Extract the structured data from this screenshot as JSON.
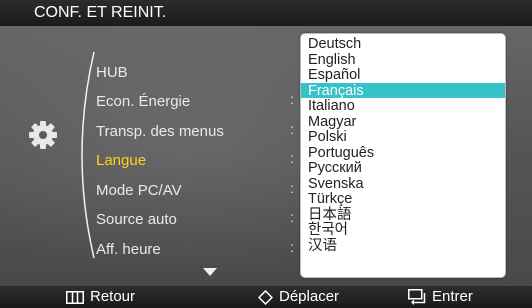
{
  "header": {
    "title": "CONF. ET REINIT."
  },
  "menu": {
    "items": [
      {
        "label": "HUB",
        "selected": false
      },
      {
        "label": "Econ. Énergie",
        "selected": false
      },
      {
        "label": "Transp. des menus",
        "selected": false
      },
      {
        "label": "Langue",
        "selected": true
      },
      {
        "label": "Mode PC/AV",
        "selected": false
      },
      {
        "label": "Source auto",
        "selected": false
      },
      {
        "label": "Aff. heure",
        "selected": false
      }
    ],
    "separator": ":"
  },
  "languages": {
    "options": [
      "Deutsch",
      "English",
      "Español",
      "Français",
      "Italiano",
      "Magyar",
      "Polski",
      "Português",
      "Русский",
      "Svenska",
      "Türkçe",
      "日本語",
      "한국어",
      "汉语"
    ],
    "selected_index": 3
  },
  "footer": {
    "back_label": "Retour",
    "move_label": "Déplacer",
    "enter_label": "Entrer"
  },
  "colors": {
    "selected_menu_text": "#ffd21e",
    "selected_language_bg": "#35c3c9",
    "header_bg": "#1b1b1b"
  },
  "icons": [
    "gear-icon",
    "menu-arc-icon",
    "scroll-down-icon",
    "menu-button-icon",
    "diamond-arrows-icon",
    "enter-icon"
  ]
}
